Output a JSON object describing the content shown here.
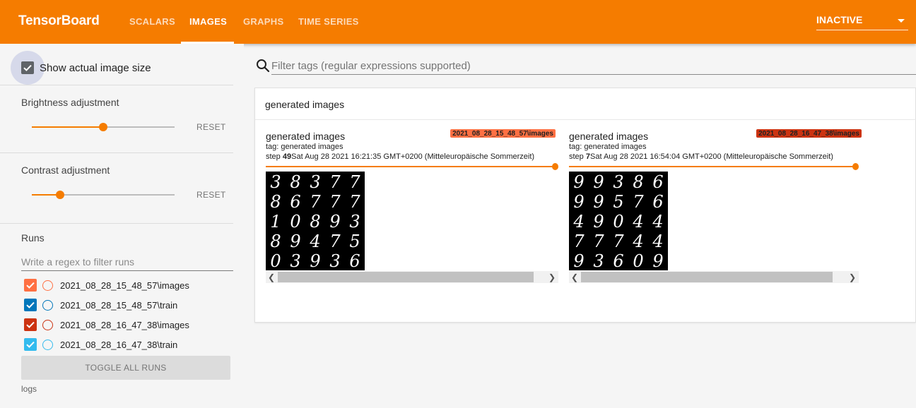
{
  "header": {
    "brand": "TensorBoard",
    "tabs": [
      {
        "label": "SCALARS"
      },
      {
        "label": "IMAGES"
      },
      {
        "label": "GRAPHS"
      },
      {
        "label": "TIME SERIES"
      }
    ],
    "active_tab": "IMAGES",
    "status_select": "INACTIVE"
  },
  "sidebar": {
    "show_actual_size": {
      "label": "Show actual image size",
      "checked": true
    },
    "brightness": {
      "label": "Brightness adjustment",
      "value": 0.5,
      "reset_label": "RESET"
    },
    "contrast": {
      "label": "Contrast adjustment",
      "value": 0.2,
      "reset_label": "RESET"
    },
    "runs": {
      "title": "Runs",
      "filter_placeholder": "Write a regex to filter runs",
      "items": [
        {
          "name": "2021_08_28_15_48_57\\images",
          "color": "#ff7043",
          "checked": true
        },
        {
          "name": "2021_08_28_15_48_57\\train",
          "color": "#0077bb",
          "checked": true
        },
        {
          "name": "2021_08_28_16_47_38\\images",
          "color": "#cc3311",
          "checked": true
        },
        {
          "name": "2021_08_28_16_47_38\\train",
          "color": "#33bbee",
          "checked": true
        }
      ],
      "toggle_label": "TOGGLE ALL RUNS",
      "logdir": "logs"
    }
  },
  "main": {
    "filter_placeholder": "Filter tags (regular expressions supported)",
    "panel": {
      "title": "generated images",
      "cards": [
        {
          "title": "generated images",
          "run": "2021_08_28_15_48_57\\images",
          "run_color": "#ff7043",
          "tag": "tag: generated images",
          "step_prefix": "step ",
          "step": "49",
          "timestamp": "Sat Aug 28 2021 16:21:35 GMT+0200 (Mitteleuropäische Sommerzeit)",
          "digits": [
            "3",
            "8",
            "3",
            "7",
            "7",
            "8",
            "6",
            "7",
            "7",
            "7",
            "1",
            "0",
            "8",
            "9",
            "3",
            "8",
            "9",
            "4",
            "7",
            "5",
            "0",
            "3",
            "9",
            "3",
            "6"
          ]
        },
        {
          "title": "generated images",
          "run": "2021_08_28_16_47_38\\images",
          "run_color": "#cc3311",
          "tag": "tag: generated images",
          "step_prefix": "step ",
          "step": "7",
          "timestamp": "Sat Aug 28 2021 16:54:04 GMT+0200 (Mitteleuropäische Sommerzeit)",
          "digits": [
            "9",
            "9",
            "3",
            "8",
            "6",
            "9",
            "9",
            "5",
            "7",
            "6",
            "4",
            "9",
            "0",
            "4",
            "4",
            "7",
            "7",
            "7",
            "4",
            "4",
            "9",
            "3",
            "6",
            "0",
            "9"
          ]
        }
      ]
    }
  },
  "icons": {
    "search": "search-icon",
    "check": "check-icon",
    "caret": "caret-down-icon",
    "scroll_left": "chevron-left-icon",
    "scroll_right": "chevron-right-icon"
  }
}
